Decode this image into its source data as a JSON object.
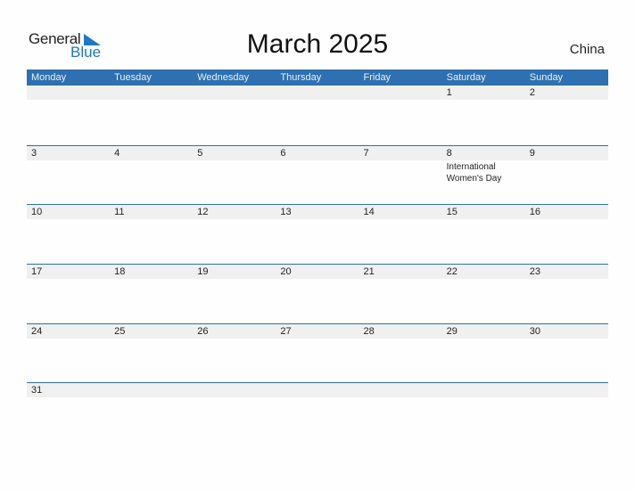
{
  "logo": {
    "word1": "General",
    "word2": "Blue"
  },
  "title": "March 2025",
  "country": "China",
  "colors": {
    "header_bg": "#2e70b0",
    "date_strip_bg": "#f0f0f0",
    "logo_blue": "#1f78c1"
  },
  "weekdays": [
    "Monday",
    "Tuesday",
    "Wednesday",
    "Thursday",
    "Friday",
    "Saturday",
    "Sunday"
  ],
  "weeks": [
    {
      "days": [
        "",
        "",
        "",
        "",
        "",
        "1",
        "2"
      ],
      "events": [
        "",
        "",
        "",
        "",
        "",
        "",
        ""
      ]
    },
    {
      "days": [
        "3",
        "4",
        "5",
        "6",
        "7",
        "8",
        "9"
      ],
      "events": [
        "",
        "",
        "",
        "",
        "",
        "International Women's Day",
        ""
      ]
    },
    {
      "days": [
        "10",
        "11",
        "12",
        "13",
        "14",
        "15",
        "16"
      ],
      "events": [
        "",
        "",
        "",
        "",
        "",
        "",
        ""
      ]
    },
    {
      "days": [
        "17",
        "18",
        "19",
        "20",
        "21",
        "22",
        "23"
      ],
      "events": [
        "",
        "",
        "",
        "",
        "",
        "",
        ""
      ]
    },
    {
      "days": [
        "24",
        "25",
        "26",
        "27",
        "28",
        "29",
        "30"
      ],
      "events": [
        "",
        "",
        "",
        "",
        "",
        "",
        ""
      ]
    },
    {
      "days": [
        "31",
        "",
        "",
        "",
        "",
        "",
        ""
      ],
      "events": [
        "",
        "",
        "",
        "",
        "",
        "",
        ""
      ]
    }
  ]
}
